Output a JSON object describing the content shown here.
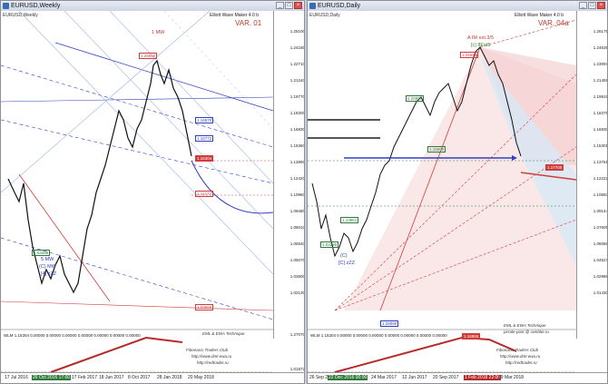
{
  "colors": {
    "bull": "#2f7a3a",
    "bear": "#111111",
    "blue": "#3040c0",
    "red": "#d23b3b",
    "ltblue": "#9bb6e6"
  },
  "left": {
    "window_title": "EURUSD,Weekly",
    "symbol_header": "EURUSD,Weekly",
    "ew_title": "Elliott Wave Maker 4.0 b",
    "variant": "VAR. 01",
    "y_ticks": [
      "1.25100",
      "1.24180",
      "1.22710",
      "1.21240",
      "1.19770",
      "1.18300",
      "1.16830",
      "1.15360",
      "1.13890",
      "1.12420",
      "1.10950",
      "1.09480",
      "1.08010",
      "1.06540",
      "1.05070",
      "1.03600",
      "1.02130",
      "1.27070",
      "1.01872"
    ],
    "x_ticks": [
      "17 Jul 2016",
      "25 Jan 2017",
      "17 Feb 2017",
      "18 Jun 2017",
      "8 Oct 2017",
      "28 Jan 2018",
      "20 May 2018"
    ],
    "x_hl": "26 Oct 2016 17:00",
    "wlm": "WLM 1.15304 0.00000 0.00000 0.00000 0.00000 0.00000 0.00000 0.00000",
    "signature_1": "EML & EWA Technique",
    "signature_2": "Fibonacci Traders Club",
    "signature_3": "http://www.dml-ewa.ru",
    "signature_4": "http://redtrader.ru",
    "wave_top": "1 MW",
    "wave_bottom_1": "5 MW",
    "wave_bottom_2": "(C) MW",
    "wave_bottom_3": "[4] zZZ",
    "price_labels": [
      "1.16570",
      "1.16772",
      "1.15304",
      "1.11472",
      "1.03658",
      "1.25550",
      "1.03286"
    ]
  },
  "right": {
    "window_title": "EURUSD,Daily",
    "symbol_header": "EURUSD,Daily",
    "ew_title": "Elliott Wave Maker 4.0 b",
    "variant": "VAR. 04a",
    "y_ticks": [
      "1.26175",
      "1.24636",
      "1.23097",
      "1.21455",
      "1.19919",
      "1.18379",
      "1.16830",
      "1.15301",
      "1.13761",
      "1.12222",
      "1.10683",
      "1.09144",
      "1.07605",
      "1.06066",
      "1.04527",
      "1.02988",
      "1.01430"
    ],
    "x_ticks": [
      "26 Sep 2016",
      "24 Mar 2017",
      "12 Jun 2017",
      "20 Sep 2017",
      "29 Mar 2018"
    ],
    "x_hl": "22 Dec 2016 00:00",
    "x_hl2": "1 Feb 2018 22:00",
    "wlm": "WLM 1.15304 0.00000 0.00000 0.00000 0.00000 0.00000 0.00000 0.00000",
    "signature_1": "EML & EWA Technique",
    "signature_2": "pirrale-post @ rambler.ru",
    "signature_3": "Fibonacci Traders Club",
    "signature_4": "http://www.dml-ewa.ru",
    "signature_5": "http://redtrader.ru",
    "wave_top": "A IM ext.3/5",
    "wave_top_2": "[c] 8Ext5",
    "wave_bottom_1": "(C)",
    "wave_bottom_2": "[C] zZZ",
    "price_labels": [
      "1.25559",
      "1.20897",
      "1.18500",
      "1.17700",
      "1.13961",
      "1.03286",
      "1.28090",
      "1.16955",
      "1.15304"
    ]
  }
}
